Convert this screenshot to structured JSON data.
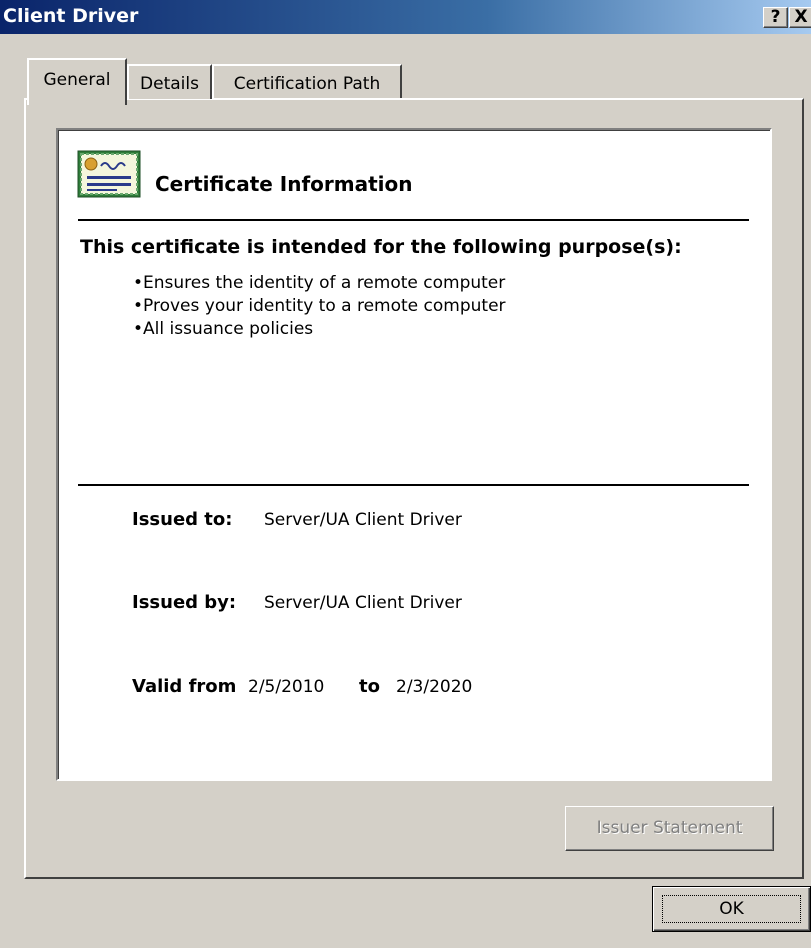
{
  "window": {
    "title": "Client Driver",
    "help_label": "?",
    "close_label": "X"
  },
  "tabs": [
    {
      "label": "General",
      "active": true
    },
    {
      "label": "Details",
      "active": false
    },
    {
      "label": "Certification Path",
      "active": false
    }
  ],
  "certificate": {
    "heading": "Certificate Information",
    "purpose_heading": "This certificate is intended for the following purpose(s):",
    "purposes": [
      "Ensures the identity of a remote computer",
      "Proves your identity to a remote computer",
      "All issuance policies"
    ],
    "issued_to_label": "Issued to:",
    "issued_to": "Server/UA Client Driver",
    "issued_by_label": "Issued by:",
    "issued_by": "Server/UA Client Driver",
    "valid_from_label": "Valid from",
    "valid_from": "2/5/2010",
    "valid_to_label": "to",
    "valid_to": "2/3/2020"
  },
  "buttons": {
    "issuer_statement": "Issuer Statement",
    "ok": "OK"
  },
  "icons": {
    "certificate": "certificate-icon",
    "help": "help-icon",
    "close": "close-icon"
  }
}
